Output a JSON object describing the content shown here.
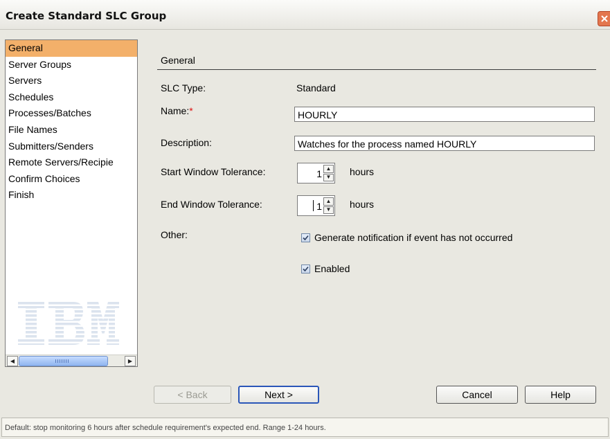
{
  "window": {
    "title": "Create Standard SLC Group"
  },
  "nav": {
    "items": [
      {
        "label": "General",
        "selected": true
      },
      {
        "label": "Server Groups"
      },
      {
        "label": "Servers"
      },
      {
        "label": "Schedules"
      },
      {
        "label": "Processes/Batches"
      },
      {
        "label": "File Names"
      },
      {
        "label": "Submitters/Senders"
      },
      {
        "label": "Remote Servers/Recipie"
      },
      {
        "label": "Confirm Choices"
      },
      {
        "label": "Finish"
      }
    ],
    "logo": "IBM"
  },
  "form": {
    "section_title": "General",
    "slc_type_label": "SLC Type:",
    "slc_type_value": "Standard",
    "name_label": "Name:",
    "name_required_mark": "*",
    "name_value": "HOURLY",
    "description_label": "Description:",
    "description_value": "Watches for the process named HOURLY",
    "start_tolerance_label": "Start Window Tolerance:",
    "start_tolerance_value": "1",
    "end_tolerance_label": "End Window Tolerance:",
    "end_tolerance_value": "1",
    "hours_unit": "hours",
    "other_label": "Other:",
    "generate_notification_label": "Generate notification if event has not occurred",
    "generate_notification_checked": true,
    "enabled_label": "Enabled",
    "enabled_checked": true
  },
  "buttons": {
    "back": "< Back",
    "next": "Next >",
    "cancel": "Cancel",
    "help": "Help"
  },
  "status": {
    "text": "Default: stop monitoring 6 hours after schedule requirement's expected end. Range 1-24 hours."
  },
  "colors": {
    "nav_selected": "#f3b06a",
    "required_mark": "#dd1111",
    "close_button": "#e3764e",
    "default_button_border": "#2a56b8"
  }
}
